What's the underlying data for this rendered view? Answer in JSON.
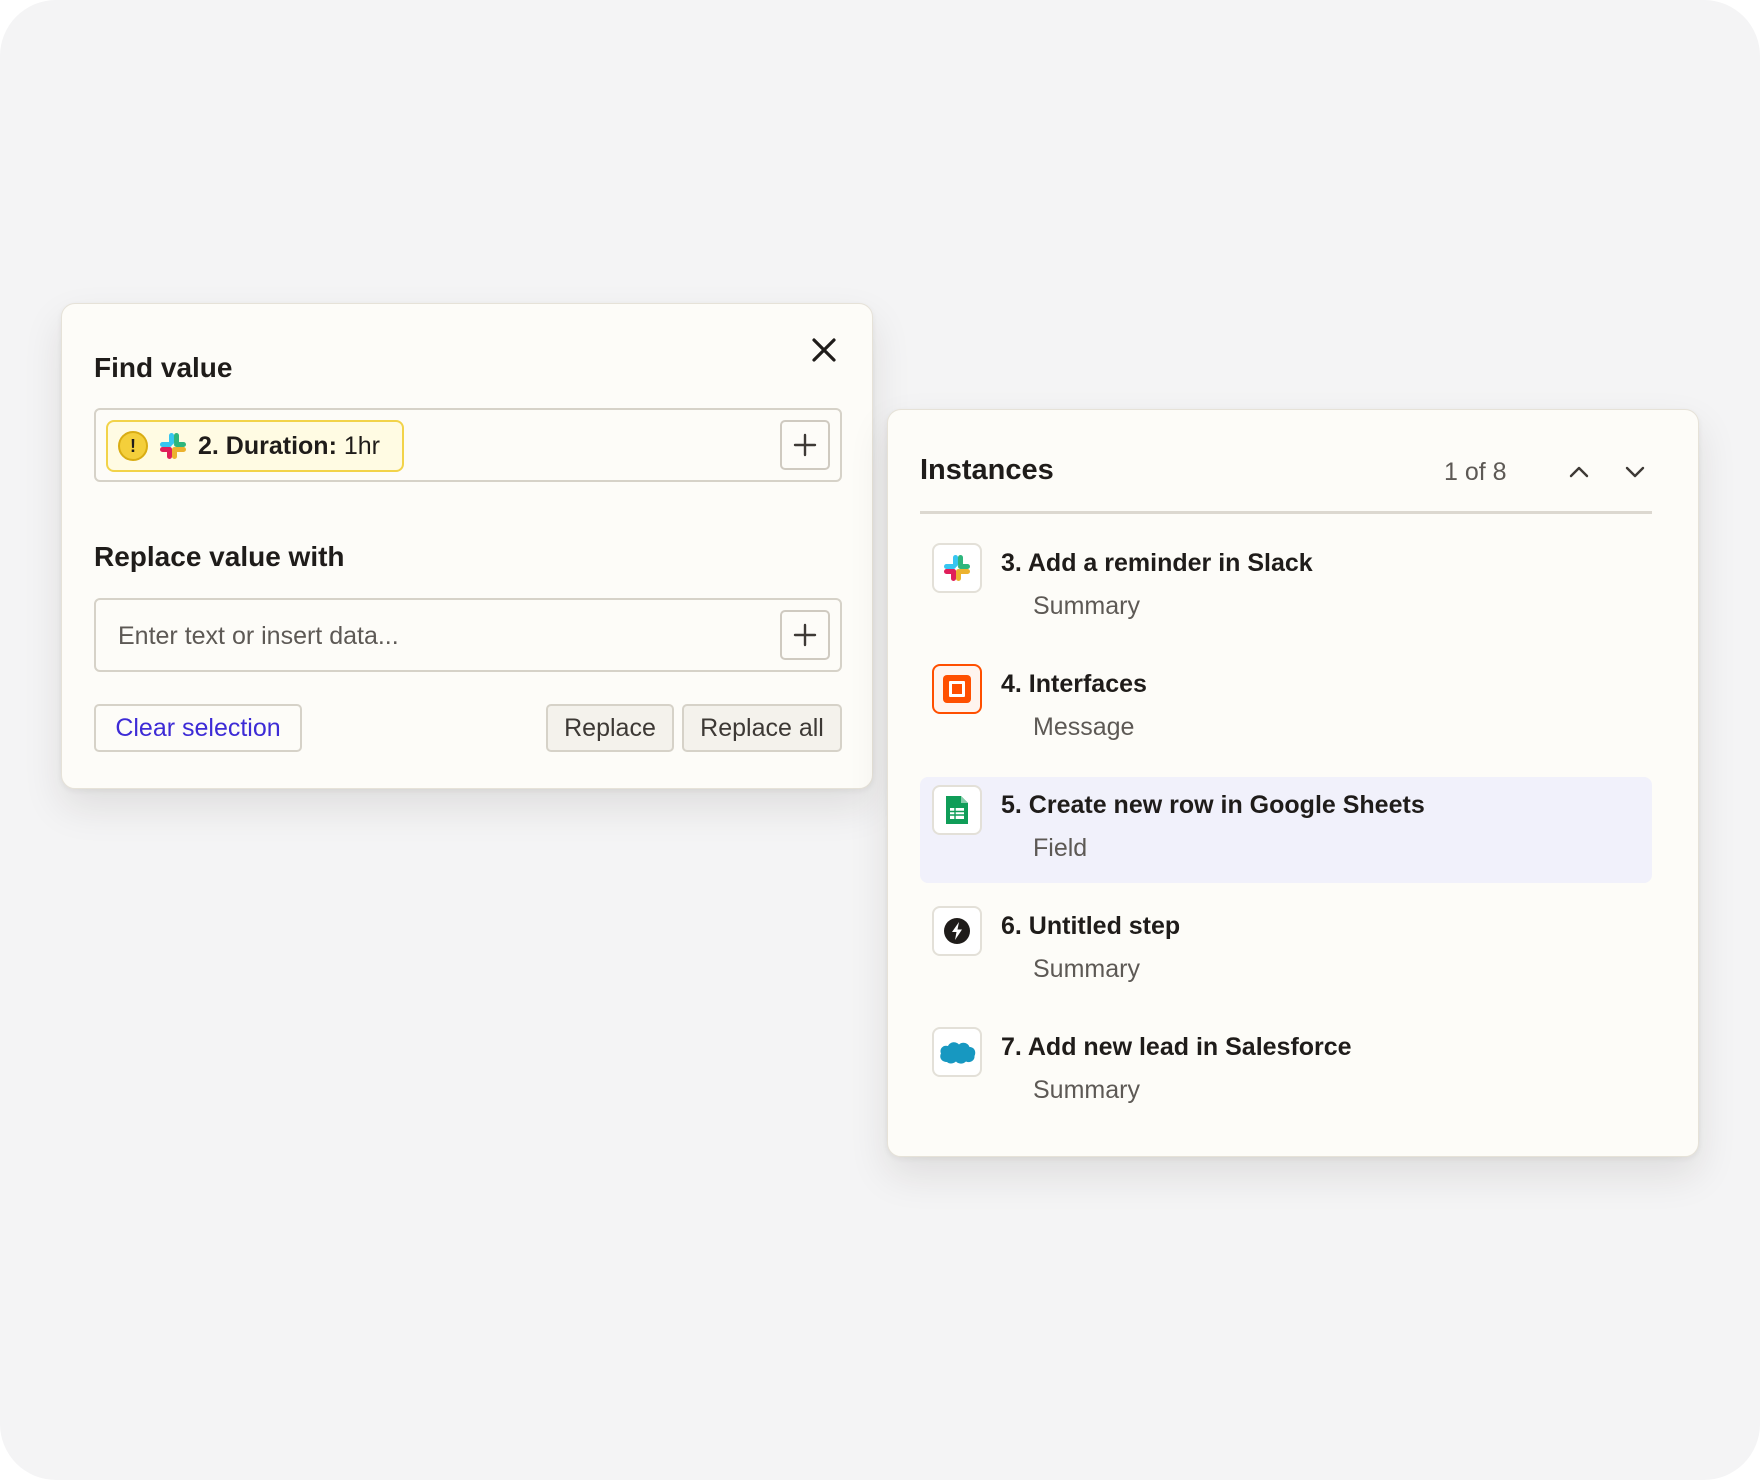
{
  "find_panel": {
    "title": "Find value",
    "pill": {
      "warning_glyph": "!",
      "app_icon": "slack-icon",
      "step": "2. Duration:",
      "value": "1hr"
    },
    "replace_title": "Replace value with",
    "replace_placeholder": "Enter text or insert data...",
    "clear_label": "Clear selection",
    "replace_label": "Replace",
    "replace_all_label": "Replace all"
  },
  "instances_panel": {
    "title": "Instances",
    "count": "1 of 8",
    "items": [
      {
        "title": "3. Add a reminder in Slack",
        "subtitle": "Summary",
        "icon": "slack-icon",
        "active": false
      },
      {
        "title": "4. Interfaces",
        "subtitle": "Message",
        "icon": "interfaces-icon",
        "active": false
      },
      {
        "title": "5. Create new row in Google Sheets",
        "subtitle": "Field",
        "icon": "google-sheets-icon",
        "active": true
      },
      {
        "title": "6. Untitled step",
        "subtitle": "Summary",
        "icon": "lightning-icon",
        "active": false
      },
      {
        "title": "7. Add new lead in Salesforce",
        "subtitle": "Summary",
        "icon": "salesforce-icon",
        "active": false
      }
    ]
  },
  "colors": {
    "canvas": "#f4f4f5",
    "card": "#fdfcf8",
    "link": "#3d2bd6",
    "pill_border": "#f2d34a",
    "active_row": "#f1f1fb"
  }
}
